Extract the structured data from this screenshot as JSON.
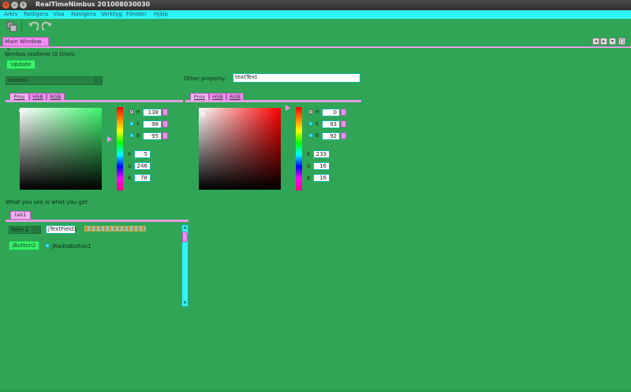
{
  "window": {
    "title": "RealTimeNimbus 201008030030"
  },
  "menu": [
    "Arkiv",
    "Redigera",
    "Visa",
    "Navigera",
    "Verktyg",
    "Fönster",
    "Hjälp"
  ],
  "toolbar": {
    "icons": [
      "save-all-icon",
      "undo-icon",
      "redo-icon"
    ]
  },
  "doc_tab": {
    "label": "Main Window",
    "close": "×"
  },
  "window_buttons": [
    "◂",
    "▸",
    "▾",
    "□"
  ],
  "main": {
    "heading": "Nimbus realtime UI tinels",
    "update_button": "Update",
    "combo_value": "control",
    "other_property_label": "Other property:",
    "other_property_value": "textText",
    "wysiwyg_label": "What you see is what you get."
  },
  "color_chooser_left": {
    "tabs": [
      "Prov",
      "HSB",
      "RGB"
    ],
    "hsb": {
      "H": "138",
      "S": "98",
      "B": "95"
    },
    "rgb": {
      "R": "5",
      "G": "246",
      "B": "78"
    },
    "swatch_color": "#3cf46b"
  },
  "color_chooser_right": {
    "tabs": [
      "Prov",
      "HSB",
      "RGB"
    ],
    "hsb": {
      "H": "0",
      "S": "93",
      "B": "92"
    },
    "rgb": {
      "R": "233",
      "G": "16",
      "B": "16"
    },
    "swatch_color": "#ff0000"
  },
  "inner_tab": {
    "label": "tab1"
  },
  "inner_panel": {
    "combo_value": "Item 1",
    "textfield_value": "jTextField1",
    "button_label": "jButton2",
    "radio_label": "jRadioButton1"
  },
  "colors": {
    "background": "#30a555",
    "accent_pink": "#f28cf2",
    "accent_cyan": "#2cf3f3",
    "button_green": "#39f26a"
  }
}
